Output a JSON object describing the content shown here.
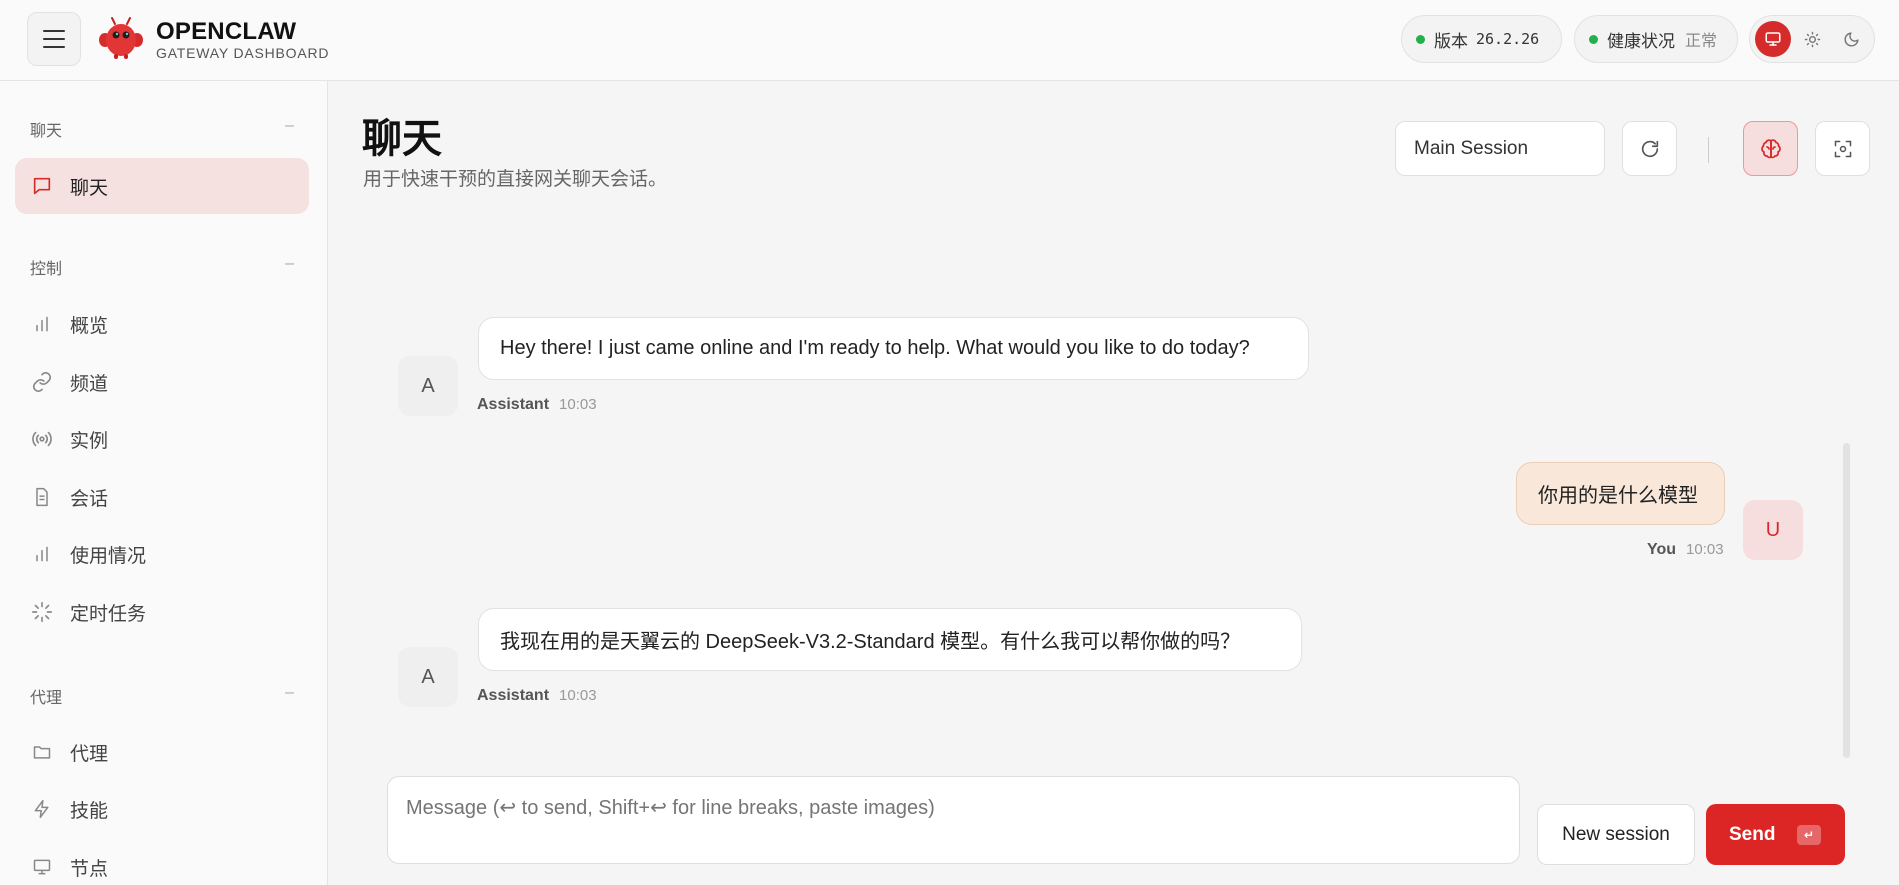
{
  "brand": {
    "title": "OPENCLAW",
    "subtitle": "GATEWAY DASHBOARD"
  },
  "status": {
    "version_label": "版本",
    "version_value": "26.2.26",
    "health_label": "健康状况",
    "health_value": "正常",
    "status_color": "#22b04b"
  },
  "theme": {
    "options": [
      "system",
      "light",
      "dark"
    ],
    "selected": "system",
    "accent": "#dc2626"
  },
  "sidebar": {
    "groups": [
      {
        "label": "聊天",
        "collapse": "–",
        "items": [
          {
            "label": "聊天",
            "icon": "chat-icon",
            "active": true
          }
        ]
      },
      {
        "label": "控制",
        "collapse": "–",
        "items": [
          {
            "label": "概览",
            "icon": "bar-chart-icon"
          },
          {
            "label": "频道",
            "icon": "link-icon"
          },
          {
            "label": "实例",
            "icon": "broadcast-icon"
          },
          {
            "label": "会话",
            "icon": "document-icon"
          },
          {
            "label": "使用情况",
            "icon": "bar-chart-icon"
          },
          {
            "label": "定时任务",
            "icon": "loader-icon"
          }
        ]
      },
      {
        "label": "代理",
        "collapse": "–",
        "items": [
          {
            "label": "代理",
            "icon": "folder-icon"
          },
          {
            "label": "技能",
            "icon": "lightning-icon"
          },
          {
            "label": "节点",
            "icon": "monitor-icon"
          }
        ]
      }
    ]
  },
  "page": {
    "title": "聊天",
    "subtitle": "用于快速干预的直接网关聊天会话。"
  },
  "toolbar": {
    "session": "Main Session",
    "refresh_icon": "refresh-icon",
    "thinking_icon": "brain-icon",
    "focus_icon": "focus-icon"
  },
  "messages": [
    {
      "role": "assistant",
      "avatar": "A",
      "author": "Assistant",
      "time": "10:03",
      "text": "Hey there! I just came online and I'm ready to help. What would you like to do today?"
    },
    {
      "role": "user",
      "avatar": "U",
      "author": "You",
      "time": "10:03",
      "text": "你用的是什么模型"
    },
    {
      "role": "assistant",
      "avatar": "A",
      "author": "Assistant",
      "time": "10:03",
      "text": "我现在用的是天翼云的 DeepSeek-V3.2-Standard 模型。有什么我可以帮你做的吗？"
    }
  ],
  "composer": {
    "placeholder": "Message (↩ to send, Shift+↩ for line breaks, paste images)",
    "new_session_label": "New session",
    "send_label": "Send",
    "send_kbd": "↵"
  }
}
